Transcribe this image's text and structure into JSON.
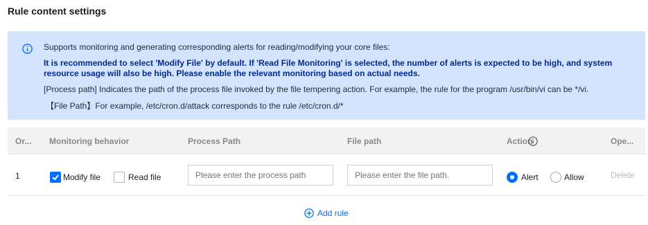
{
  "section_title": "Rule content settings",
  "info": {
    "icon": "info-icon",
    "line1": "Supports monitoring and generating corresponding alerts for reading/modifying your core files:",
    "line2": "It is recommended to select 'Modify File' by default. If 'Read File Monitoring' is selected, the number of alerts is expected to be high, and system",
    "line3": "resource usage will also be high. Please enable the relevant monitoring based on actual needs.",
    "line4": "[Process path] Indicates the path of the process file invoked by the file tempering action. For example, the rule for the program /usr/bin/vi can be */vi.",
    "line5": "【File Path】For example, /etc/cron.d/attack corresponds to the rule /etc/cron.d/*"
  },
  "table": {
    "headers": {
      "order": "Or...",
      "behavior": "Monitoring behavior",
      "process": "Process Path",
      "file": "File path",
      "action": "Action",
      "operation": "Ope..."
    },
    "rows": [
      {
        "order": "1",
        "modify_label": "Modify file",
        "modify_checked": true,
        "read_label": "Read file",
        "read_checked": false,
        "process_placeholder": "Please enter the process path",
        "file_placeholder": "Please enter the file path.",
        "alert_label": "Alert",
        "allow_label": "Allow",
        "selected_action": "Alert",
        "delete_label": "Delete"
      }
    ]
  },
  "add_rule_label": "Add rule",
  "colors": {
    "accent": "#006eff",
    "info_bg": "#d4e4ff",
    "info_bold": "#002a8f",
    "header_bg": "#f2f2f2"
  }
}
